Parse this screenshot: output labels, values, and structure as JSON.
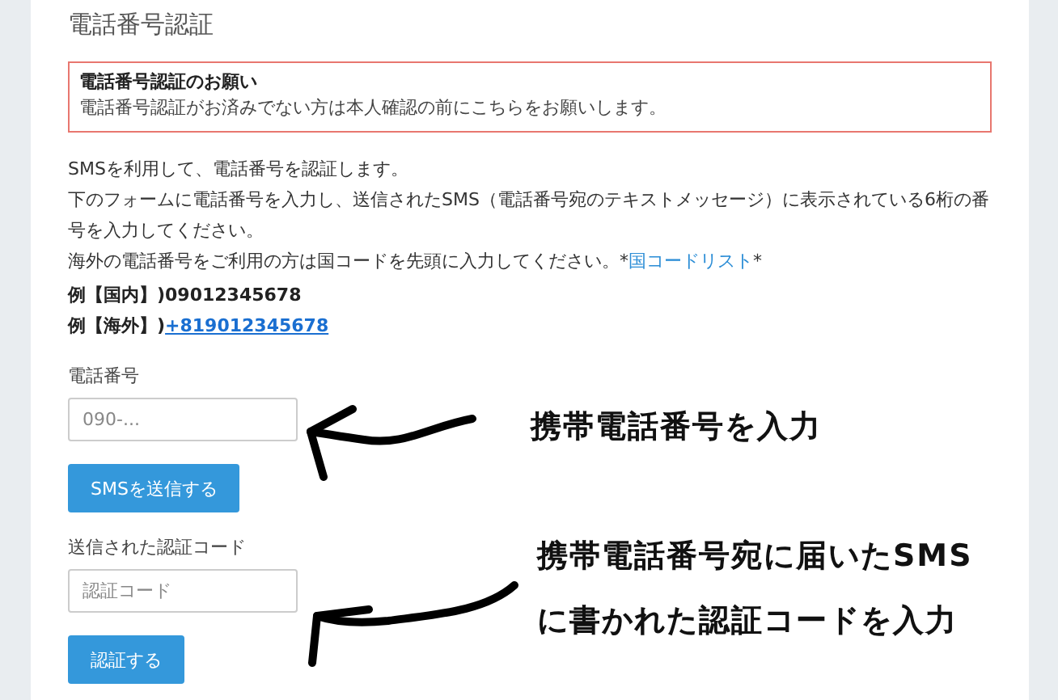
{
  "title": "電話番号認証",
  "notice": {
    "heading": "電話番号認証のお願い",
    "body": "電話番号認証がお済みでない方は本人確認の前にこちらをお願いします。"
  },
  "intro": [
    "SMSを利用して、電話番号を認証します。",
    "下のフォームに電話番号を入力し、送信されたSMS（電話番号宛のテキストメッセージ）に表示されている6桁の番号を入力してください。"
  ],
  "overseas_note": {
    "text": "海外の電話番号をご利用の方は国コードを先頭に入力してください。*",
    "link": "国コードリスト",
    "after": "*"
  },
  "examples": [
    {
      "label": "例【国内】)",
      "value": "09012345678",
      "kind": "text"
    },
    {
      "label": "例【海外】)",
      "value": "+819012345678",
      "kind": "link"
    }
  ],
  "forms": [
    {
      "label": "電話番号",
      "placeholder": "090-...",
      "button": "SMSを送信する"
    },
    {
      "label": "送信された認証コード",
      "placeholder": "認証コード",
      "button": "認証する"
    }
  ],
  "annotations": [
    {
      "lines": [
        "携帯電話番号を入力"
      ]
    },
    {
      "lines": [
        "携帯電話番号宛に届いたSMS",
        "に書かれた認証コードを入力"
      ]
    }
  ]
}
